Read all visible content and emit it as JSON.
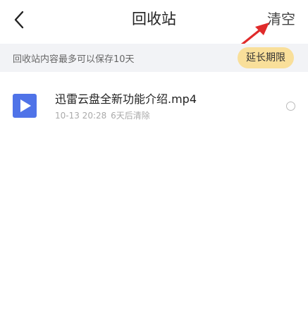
{
  "header": {
    "title": "回收站",
    "clear_label": "清空"
  },
  "notice": {
    "text": "回收站内容最多可以保存10天",
    "extend_label": "延长期限"
  },
  "files": [
    {
      "name": "迅雷云盘全新功能介绍.mp4",
      "date": "10-13 20:28",
      "expiry": "6天后清除"
    }
  ],
  "colors": {
    "accent": "#4f73e8",
    "extend_bg": "#f9df9a",
    "notice_bg": "#f2f3f6",
    "annotation_arrow": "#e02a2a"
  },
  "icons": {
    "back": "chevron-left-icon",
    "file": "video-play-icon",
    "annotation": "red-arrow-icon"
  }
}
